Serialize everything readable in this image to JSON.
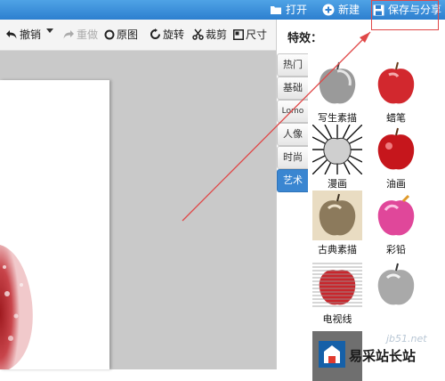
{
  "topbar": {
    "open_label": "打开",
    "new_label": "新建",
    "save_share_label": "保存与分享"
  },
  "toolbar": {
    "undo_label": "撤销",
    "redo_label": "重做",
    "original_label": "原图",
    "rotate_label": "旋转",
    "crop_label": "裁剪",
    "size_label": "尺寸"
  },
  "effects_panel": {
    "title": "特效：",
    "tabs": [
      {
        "label": "热门",
        "active": false
      },
      {
        "label": "基础",
        "active": false
      },
      {
        "label": "Lomo",
        "active": false
      },
      {
        "label": "人像",
        "active": false
      },
      {
        "label": "时尚",
        "active": false
      },
      {
        "label": "艺术",
        "active": true
      }
    ],
    "items": [
      {
        "label": "写生素描"
      },
      {
        "label": "蜡笔"
      },
      {
        "label": "漫画"
      },
      {
        "label": "油画"
      },
      {
        "label": "古典素描"
      },
      {
        "label": "彩铅"
      },
      {
        "label": "电视线"
      },
      {
        "label": ""
      }
    ]
  },
  "watermark": {
    "site_name": "易采站长站",
    "url": "jb51.net"
  },
  "colors": {
    "topbar": "#2d7fcf",
    "active_tab": "#3a86d1",
    "annotation": "#e04848"
  }
}
